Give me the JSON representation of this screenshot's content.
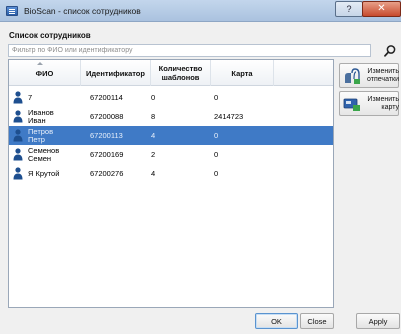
{
  "window": {
    "title": "BioScan - список сотрудников",
    "help_glyph": "?",
    "close_glyph": "✕"
  },
  "list_title": "Список сотрудников",
  "filter": {
    "placeholder": "Фильтр по ФИО или идентификатору",
    "value": ""
  },
  "table": {
    "columns": [
      "ФИО",
      "Идентификатор",
      "Количество шаблонов",
      "Карта"
    ],
    "rows": [
      {
        "name": "7",
        "id": "67200114",
        "templates": "0",
        "card": "0",
        "selected": false
      },
      {
        "name": "Иванов Иван",
        "id": "67200088",
        "templates": "8",
        "card": "2414723",
        "selected": false
      },
      {
        "name": "Петров Петр",
        "id": "67200113",
        "templates": "4",
        "card": "0",
        "selected": true
      },
      {
        "name": "Семенов Семен",
        "id": "67200169",
        "templates": "2",
        "card": "0",
        "selected": false
      },
      {
        "name": "Я Крутой",
        "id": "67200276",
        "templates": "4",
        "card": "0",
        "selected": false
      }
    ]
  },
  "side_buttons": {
    "change_fingerprints": "Изменить отпечатки",
    "change_card": "Изменить карту"
  },
  "bottom_buttons": {
    "ok": "OK",
    "close": "Close",
    "apply": "Apply"
  },
  "icons": {
    "app": "app-icon",
    "search": "search-icon",
    "user": "user-icon",
    "fingerprint": "fingerprint-icon",
    "card": "card-icon"
  },
  "colors": {
    "selection": "#3f7ac6",
    "user_icon": "#1e4f8f"
  }
}
